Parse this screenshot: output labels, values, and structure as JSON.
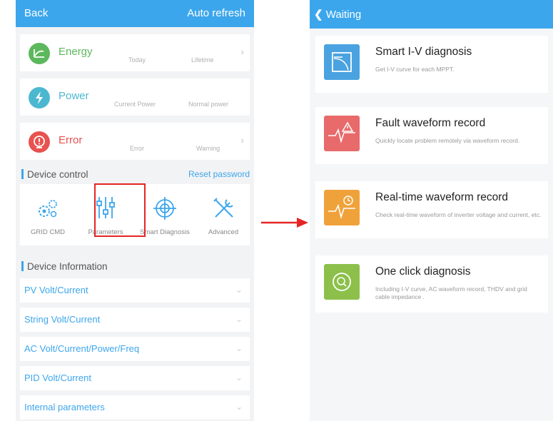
{
  "left": {
    "topbar": {
      "back": "Back",
      "auto_refresh": "Auto refresh"
    },
    "cards": [
      {
        "title": "Energy",
        "sub1": "Today",
        "sub2": "Lifetime",
        "color": "#5cb85c"
      },
      {
        "title": "Power",
        "sub1": "Current Power",
        "sub2": "Normal power",
        "color": "#4bb8d0"
      },
      {
        "title": "Error",
        "sub1": "Error",
        "sub2": "Warning",
        "color": "#e8524f"
      }
    ],
    "device_control": {
      "title": "Device control",
      "action": "Reset password"
    },
    "controls": [
      {
        "label": "GRID CMD",
        "icon": "gear-cluster-icon"
      },
      {
        "label": "Parameters",
        "icon": "sliders-icon"
      },
      {
        "label": "Smart Diagnosis",
        "icon": "target-icon"
      },
      {
        "label": "Advanced",
        "icon": "tools-icon"
      }
    ],
    "device_information": {
      "title": "Device Information"
    },
    "info_items": [
      "PV Volt/Current",
      "String Volt/Current",
      "AC Volt/Current/Power/Freq",
      "PID Volt/Current",
      "Internal parameters"
    ]
  },
  "right": {
    "topbar": {
      "back": "Waiting"
    },
    "items": [
      {
        "title": "Smart I-V diagnosis",
        "desc": "Get I-V curve for each MPPT.",
        "color": "#4aa3e0",
        "icon": "iv-curve-icon"
      },
      {
        "title": "Fault waveform record",
        "desc": "Quickly locate problem remotely via waveform record.",
        "color": "#e86a6a",
        "icon": "fault-waveform-icon"
      },
      {
        "title": "Real-time waveform record",
        "desc": "Check real-time waveform of inverter voltage and current, etc.",
        "color": "#f0a23a",
        "icon": "realtime-waveform-icon"
      },
      {
        "title": "One click diagnosis",
        "desc": "Including I-V curve, AC waveform record, THDV and grid cable impedance .",
        "color": "#8cc04b",
        "icon": "one-click-icon"
      }
    ]
  },
  "colors": {
    "accent": "#3ca6ec",
    "highlight": "#e52425"
  }
}
